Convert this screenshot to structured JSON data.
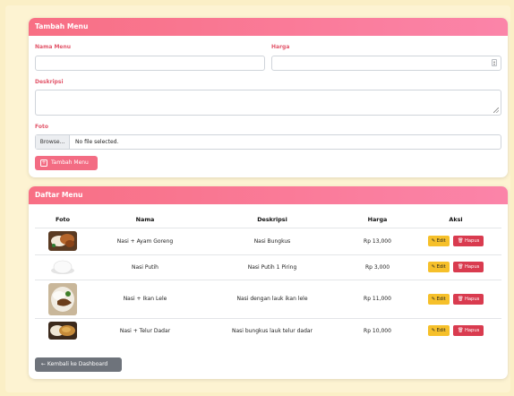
{
  "form": {
    "header": "Tambah Menu",
    "nama_label": "Nama Menu",
    "harga_label": "Harga",
    "deskripsi_label": "Deskripsi",
    "foto_label": "Foto",
    "browse_label": "Browse...",
    "file_status": "No file selected.",
    "submit_label": "Tambah Menu",
    "nama_value": "",
    "harga_value": "",
    "deskripsi_value": ""
  },
  "list": {
    "header": "Daftar Menu",
    "columns": [
      "Foto",
      "Nama",
      "Deskripsi",
      "Harga",
      "Aksi"
    ],
    "rows": [
      {
        "nama": "Nasi + Ayam Goreng",
        "deskripsi": "Nasi Bungkus",
        "harga": "Rp 13,000"
      },
      {
        "nama": "Nasi Putih",
        "deskripsi": "Nasi Putih 1 Piring",
        "harga": "Rp 3,000"
      },
      {
        "nama": "Nasi + Ikan Lele",
        "deskripsi": "Nasi dengan lauk ikan lele",
        "harga": "Rp 11,000"
      },
      {
        "nama": "Nasi + Telur Dadar",
        "deskripsi": "Nasi bungkus lauk telur dadar",
        "harga": "Rp 10,000"
      }
    ],
    "edit_label": "Edit",
    "delete_label": "Hapus"
  },
  "back_label": "← Kembali ke Dashboard",
  "colors": {
    "accent": "#f86f84",
    "edit": "#f6c02a",
    "delete": "#d93b4f",
    "back": "#6e737b",
    "page_bg": "#fbefc6"
  }
}
